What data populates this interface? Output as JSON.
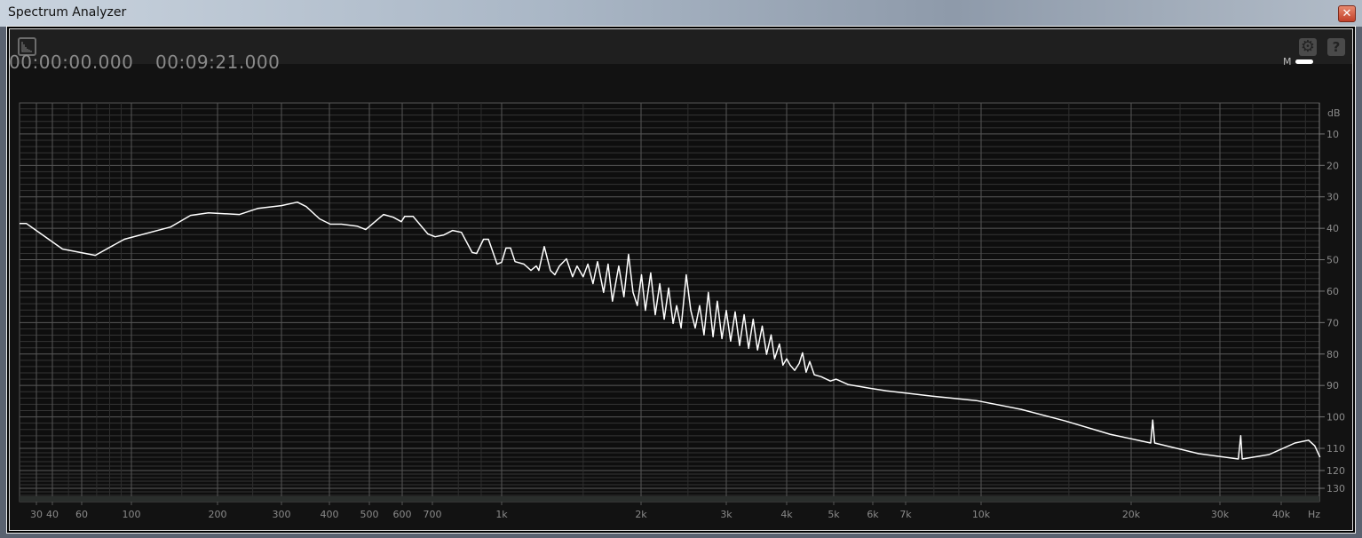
{
  "window": {
    "title": "Spectrum Analyzer",
    "close_label": "✕"
  },
  "toolbar": {
    "view_icon": "spectrum-view-icon",
    "settings_icon": "gear-icon",
    "help_label": "?"
  },
  "times": {
    "start": "00:00:00.000",
    "end": "00:09:21.000"
  },
  "legend": {
    "label": "M",
    "color": "#ffffff"
  },
  "chart_data": {
    "type": "line",
    "title": "",
    "xlabel": "Hz",
    "ylabel": "dB",
    "xscale": "log-warped",
    "xlim": [
      22,
      49000
    ],
    "ylim": [
      0,
      135
    ],
    "x_ticks": [
      {
        "v": 30,
        "l": "30"
      },
      {
        "v": 40,
        "l": "40"
      },
      {
        "v": 60,
        "l": "60"
      },
      {
        "v": 100,
        "l": "100"
      },
      {
        "v": 200,
        "l": "200"
      },
      {
        "v": 300,
        "l": "300"
      },
      {
        "v": 400,
        "l": "400"
      },
      {
        "v": 500,
        "l": "500"
      },
      {
        "v": 600,
        "l": "600"
      },
      {
        "v": 700,
        "l": "700"
      },
      {
        "v": 1000,
        "l": "1k"
      },
      {
        "v": 2000,
        "l": "2k"
      },
      {
        "v": 3000,
        "l": "3k"
      },
      {
        "v": 4000,
        "l": "4k"
      },
      {
        "v": 5000,
        "l": "5k"
      },
      {
        "v": 6000,
        "l": "6k"
      },
      {
        "v": 7000,
        "l": "7k"
      },
      {
        "v": 10000,
        "l": "10k"
      },
      {
        "v": 20000,
        "l": "20k"
      },
      {
        "v": 30000,
        "l": "30k"
      },
      {
        "v": 40000,
        "l": "40k"
      }
    ],
    "y_ticks": [
      10,
      20,
      30,
      40,
      50,
      60,
      70,
      80,
      90,
      100,
      110,
      120,
      130
    ],
    "grid": true,
    "series": [
      {
        "name": "M",
        "color": "#ffffff",
        "points": [
          [
            22,
            38.5
          ],
          [
            25,
            38.5
          ],
          [
            46,
            46.6
          ],
          [
            69,
            48.6
          ],
          [
            93,
            43.5
          ],
          [
            137,
            39.6
          ],
          [
            161,
            35.9
          ],
          [
            186,
            35.1
          ],
          [
            230,
            35.6
          ],
          [
            258,
            33.7
          ],
          [
            300,
            32.8
          ],
          [
            330,
            31.7
          ],
          [
            348,
            33.1
          ],
          [
            377,
            37
          ],
          [
            402,
            38.7
          ],
          [
            428,
            38.7
          ],
          [
            467,
            39.3
          ],
          [
            490,
            40.4
          ],
          [
            541,
            35.6
          ],
          [
            571,
            36.5
          ],
          [
            597,
            37.9
          ],
          [
            608,
            36.2
          ],
          [
            634,
            36.2
          ],
          [
            684,
            41.8
          ],
          [
            710,
            42.7
          ],
          [
            743,
            42.1
          ],
          [
            777,
            40.7
          ],
          [
            813,
            41.3
          ],
          [
            859,
            47.7
          ],
          [
            879,
            48
          ],
          [
            911,
            43.5
          ],
          [
            934,
            43.5
          ],
          [
            977,
            51.4
          ],
          [
            1000,
            50.8
          ],
          [
            1022,
            46.3
          ],
          [
            1045,
            46.3
          ],
          [
            1069,
            50.6
          ],
          [
            1117,
            51.4
          ],
          [
            1157,
            53.4
          ],
          [
            1188,
            52
          ],
          [
            1203,
            53.4
          ],
          [
            1236,
            45.8
          ],
          [
            1274,
            53.4
          ],
          [
            1303,
            54.8
          ],
          [
            1333,
            52
          ],
          [
            1380,
            49.7
          ],
          [
            1423,
            55.4
          ],
          [
            1455,
            52
          ],
          [
            1500,
            55.4
          ],
          [
            1535,
            51.4
          ],
          [
            1575,
            57.6
          ],
          [
            1611,
            50.6
          ],
          [
            1660,
            60.4
          ],
          [
            1698,
            51.4
          ],
          [
            1735,
            63.2
          ],
          [
            1790,
            52
          ],
          [
            1837,
            61.8
          ],
          [
            1879,
            48.3
          ],
          [
            1922,
            60.4
          ],
          [
            1963,
            64.6
          ],
          [
            2004,
            54.8
          ],
          [
            2042,
            66.1
          ],
          [
            2094,
            54.2
          ],
          [
            2140,
            67.5
          ],
          [
            2186,
            57.6
          ],
          [
            2233,
            68.9
          ],
          [
            2281,
            59
          ],
          [
            2329,
            70.3
          ],
          [
            2369,
            64.6
          ],
          [
            2420,
            71.7
          ],
          [
            2480,
            54.8
          ],
          [
            2534,
            66.1
          ],
          [
            2588,
            71.7
          ],
          [
            2643,
            64.6
          ],
          [
            2698,
            73.9
          ],
          [
            2755,
            60.4
          ],
          [
            2817,
            74.5
          ],
          [
            2875,
            63.2
          ],
          [
            2938,
            75.1
          ],
          [
            3000,
            66.1
          ],
          [
            3063,
            75.9
          ],
          [
            3130,
            66.6
          ],
          [
            3197,
            77.3
          ],
          [
            3266,
            67.5
          ],
          [
            3338,
            78.2
          ],
          [
            3410,
            68.9
          ],
          [
            3482,
            78.7
          ],
          [
            3560,
            71.1
          ],
          [
            3636,
            80.1
          ],
          [
            3715,
            73.9
          ],
          [
            3776,
            81.5
          ],
          [
            3865,
            76.8
          ],
          [
            3929,
            83.5
          ],
          [
            4000,
            81.5
          ],
          [
            4066,
            83.5
          ],
          [
            4154,
            85.2
          ],
          [
            4245,
            83
          ],
          [
            4314,
            79.6
          ],
          [
            4386,
            85.8
          ],
          [
            4462,
            82.4
          ],
          [
            4560,
            86.6
          ],
          [
            4711,
            87.2
          ],
          [
            4920,
            88.6
          ],
          [
            5054,
            88
          ],
          [
            5345,
            89.7
          ],
          [
            5925,
            90.9
          ],
          [
            6400,
            91.7
          ],
          [
            7943,
            93.4
          ],
          [
            9776,
            94.8
          ],
          [
            12030,
            97.6
          ],
          [
            14760,
            101.3
          ],
          [
            18130,
            105.5
          ],
          [
            21870,
            108.3
          ],
          [
            22070,
            101
          ],
          [
            22270,
            108.3
          ],
          [
            27230,
            112.4
          ],
          [
            32700,
            114.8
          ],
          [
            33070,
            106
          ],
          [
            33310,
            114.8
          ],
          [
            37790,
            112.8
          ],
          [
            42760,
            108.3
          ],
          [
            45680,
            107.4
          ],
          [
            47100,
            109.2
          ],
          [
            48300,
            114
          ]
        ]
      }
    ]
  }
}
